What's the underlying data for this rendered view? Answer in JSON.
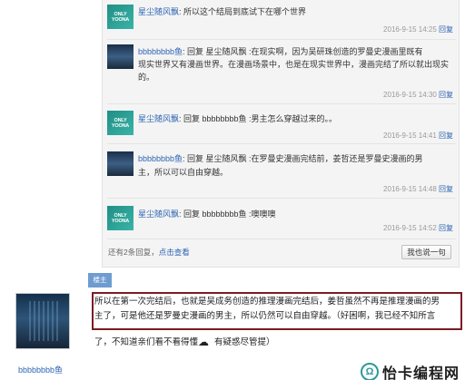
{
  "replies": [
    {
      "avatar": "green",
      "user": "星尘随风飘",
      "text": ": 所以这个结局到底试下在哪个世界",
      "text2": "",
      "time": "2016-9-15 14:25",
      "reply_label": "回复"
    },
    {
      "avatar": "dark",
      "user": "bbbbbbbb鱼",
      "text": ": 回复 星尘随风飘 :在现实啊，因为吴研珠创造的罗曼史漫画里既有",
      "text2": "现实世界又有漫画世界。在漫画场景中，也是在现实世界中，漫画完结了所以就出现实的。",
      "time": "2016-9-15 14:30",
      "reply_label": "回复"
    },
    {
      "avatar": "green",
      "user": "星尘随风飘",
      "text": ": 回复 bbbbbbbb鱼 :男主怎么穿越过来的。。",
      "text2": "",
      "time": "2016-9-15 14:41",
      "reply_label": "回复"
    },
    {
      "avatar": "dark",
      "user": "bbbbbbbb鱼",
      "text": ": 回复 星尘随风飘 :在罗曼史漫画完结前，姜哲还是罗曼史漫画的男",
      "text2": "主，所以可以自由穿越。",
      "time": "2016-9-15 14:48",
      "reply_label": "回复"
    },
    {
      "avatar": "green",
      "user": "星尘随风飘",
      "text": ": 回复 bbbbbbbb鱼 :噢噢噢",
      "text2": "",
      "time": "2016-9-15 14:52",
      "reply_label": "回复"
    }
  ],
  "avatar_text": "ONLY\nYOONA",
  "footer": {
    "more_prefix": "还有2条回复，",
    "more_link": "点击查看",
    "say_button": "我也说一句"
  },
  "main_post": {
    "badge": "楼主",
    "user": "bbbbbbbb鱼",
    "line1": "所以在第一次完结后，也就是吴成务创造的推理漫画完结后，姜哲虽然不再是推理漫画的男",
    "line2": "主了，可是他还是罗曼史漫画的男主，所以仍然可以自由穿越。（好困啊，我已经不知所言",
    "line3a": "了，不知道亲们看不看得懂",
    "line3b": "有疑惑尽管提）"
  },
  "watermark": {
    "symbol": "Ω",
    "text": "怡卡编程网"
  },
  "colors": {
    "link": "#2d64b3",
    "highlight_border": "#7b1c24",
    "badge": "#6e9cd1"
  }
}
